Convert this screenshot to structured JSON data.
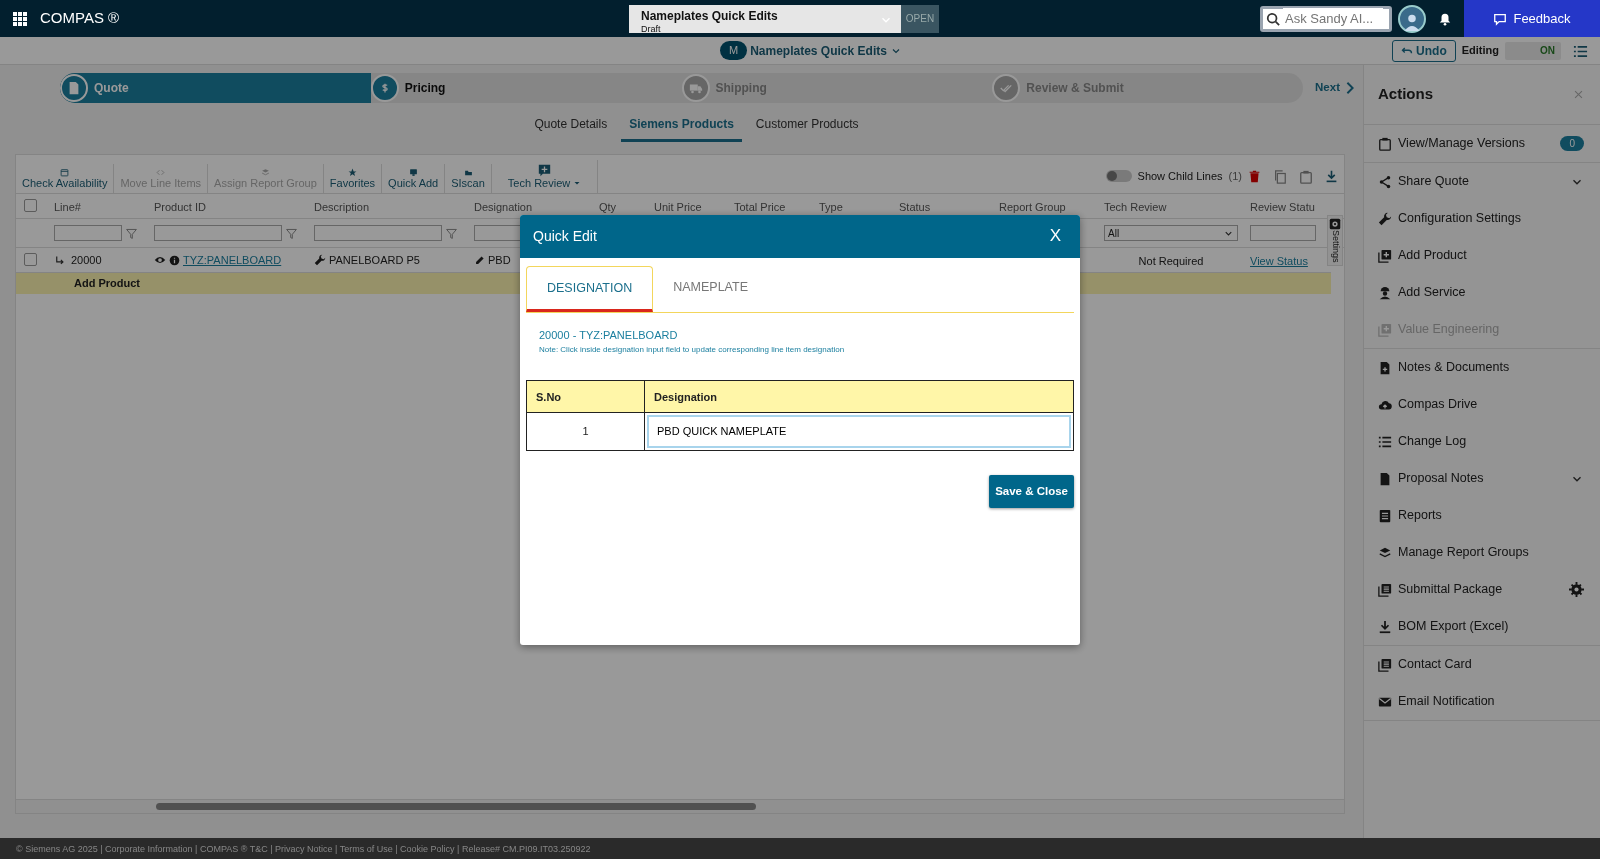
{
  "app": {
    "title": "COMPAS ®"
  },
  "quote_selector": {
    "name": "Nameplates Quick Edits",
    "status": "Draft",
    "badge": "OPEN"
  },
  "search": {
    "placeholder": "Ask Sandy AI..."
  },
  "feedback": "Feedback",
  "subheader": {
    "badge": "M",
    "title": "Nameplates Quick Edits",
    "undo": "Undo",
    "editing_label": "Editing",
    "toggle": {
      "label": "ON",
      "on": true
    }
  },
  "steps": [
    {
      "label": "Quote",
      "completed": true,
      "selected": false
    },
    {
      "label": "Pricing",
      "completed": false,
      "selected": true
    },
    {
      "label": "Shipping",
      "completed": false,
      "selected": false
    },
    {
      "label": "Review & Submit",
      "completed": false,
      "selected": false
    }
  ],
  "next": "Next",
  "tabs": [
    {
      "label": "Quote Details",
      "selected": false
    },
    {
      "label": "Siemens Products",
      "selected": true
    },
    {
      "label": "Customer Products",
      "selected": false
    }
  ],
  "toolbar": [
    {
      "label": "Check Availability",
      "disabled": false
    },
    {
      "label": "Move Line Items",
      "disabled": true
    },
    {
      "label": "Assign Report Group",
      "disabled": true
    },
    {
      "label": "Favorites",
      "disabled": false
    },
    {
      "label": "Quick Add",
      "disabled": false
    },
    {
      "label": "SIscan",
      "disabled": false
    },
    {
      "label": "Tech Review",
      "disabled": false,
      "dropdown": true
    }
  ],
  "child_lines": {
    "label": "Show Child Lines",
    "count": "(1)",
    "on": false
  },
  "table": {
    "select_all_checked": false,
    "columns": [
      {
        "label": "Line#",
        "filter": {
          "kind": "text"
        }
      },
      {
        "label": "Product ID",
        "filter": {
          "kind": "text"
        }
      },
      {
        "label": "Description",
        "filter": {
          "kind": "text"
        }
      },
      {
        "label": "Designation",
        "filter": {
          "kind": "text"
        }
      },
      {
        "label": "Qty"
      },
      {
        "label": "Unit Price"
      },
      {
        "label": "Total Price"
      },
      {
        "label": "Type"
      },
      {
        "label": "Status"
      },
      {
        "label": "Report Group"
      },
      {
        "label": "Tech Review",
        "filter": {
          "kind": "select",
          "value": "All"
        }
      },
      {
        "label": "Review Statu",
        "filter": {
          "kind": "text"
        }
      }
    ],
    "rows": [
      {
        "checked": false,
        "line": "20000",
        "product_id": "TYZ:PANELBOARD",
        "description": "PANELBOARD P5",
        "designation": "PBD",
        "tech_review": "Not Required",
        "review_status": "View Status"
      }
    ],
    "add_row": "Add Product"
  },
  "settings_tab": "Settings",
  "actions": {
    "title": "Actions",
    "groups": [
      [
        {
          "label": "View/Manage Versions",
          "badge": "0",
          "disabled": false
        }
      ],
      [
        {
          "label": "Share Quote",
          "disabled": false,
          "expandable": true
        },
        {
          "label": "Configuration Settings",
          "disabled": false
        },
        {
          "label": "Add Product",
          "disabled": false
        },
        {
          "label": "Add Service",
          "disabled": false
        },
        {
          "label": "Value Engineering",
          "disabled": true
        }
      ],
      [
        {
          "label": "Notes & Documents",
          "disabled": false
        },
        {
          "label": "Compas Drive",
          "disabled": false
        },
        {
          "label": "Change Log",
          "disabled": false
        },
        {
          "label": "Proposal Notes",
          "disabled": false,
          "expandable": true
        },
        {
          "label": "Reports",
          "disabled": false
        },
        {
          "label": "Manage Report Groups",
          "disabled": false
        },
        {
          "label": "Submittal Package",
          "disabled": false,
          "settings": true
        },
        {
          "label": "BOM Export (Excel)",
          "disabled": false
        }
      ],
      [
        {
          "label": "Contact Card",
          "disabled": false
        },
        {
          "label": "Email Notification",
          "disabled": false
        }
      ]
    ]
  },
  "modal": {
    "title": "Quick Edit",
    "close": "X",
    "tabs": [
      {
        "label": "DESIGNATION",
        "selected": true
      },
      {
        "label": "NAMEPLATE",
        "selected": false
      }
    ],
    "heading": "20000 - TYZ:PANELBOARD",
    "note": "Note: Click inside designation input field to update corresponding line item designation",
    "columns": [
      "S.No",
      "Designation"
    ],
    "rows": [
      {
        "sno": "1",
        "designation": "PBD QUICK NAMEPLATE"
      }
    ],
    "save": "Save & Close"
  },
  "footer": "© Siemens AG 2025 | Corporate Information | COMPAS ® T&C | Privacy Notice | Terms of Use | Cookie Policy | Release# CM.PI09.IT03.250922"
}
